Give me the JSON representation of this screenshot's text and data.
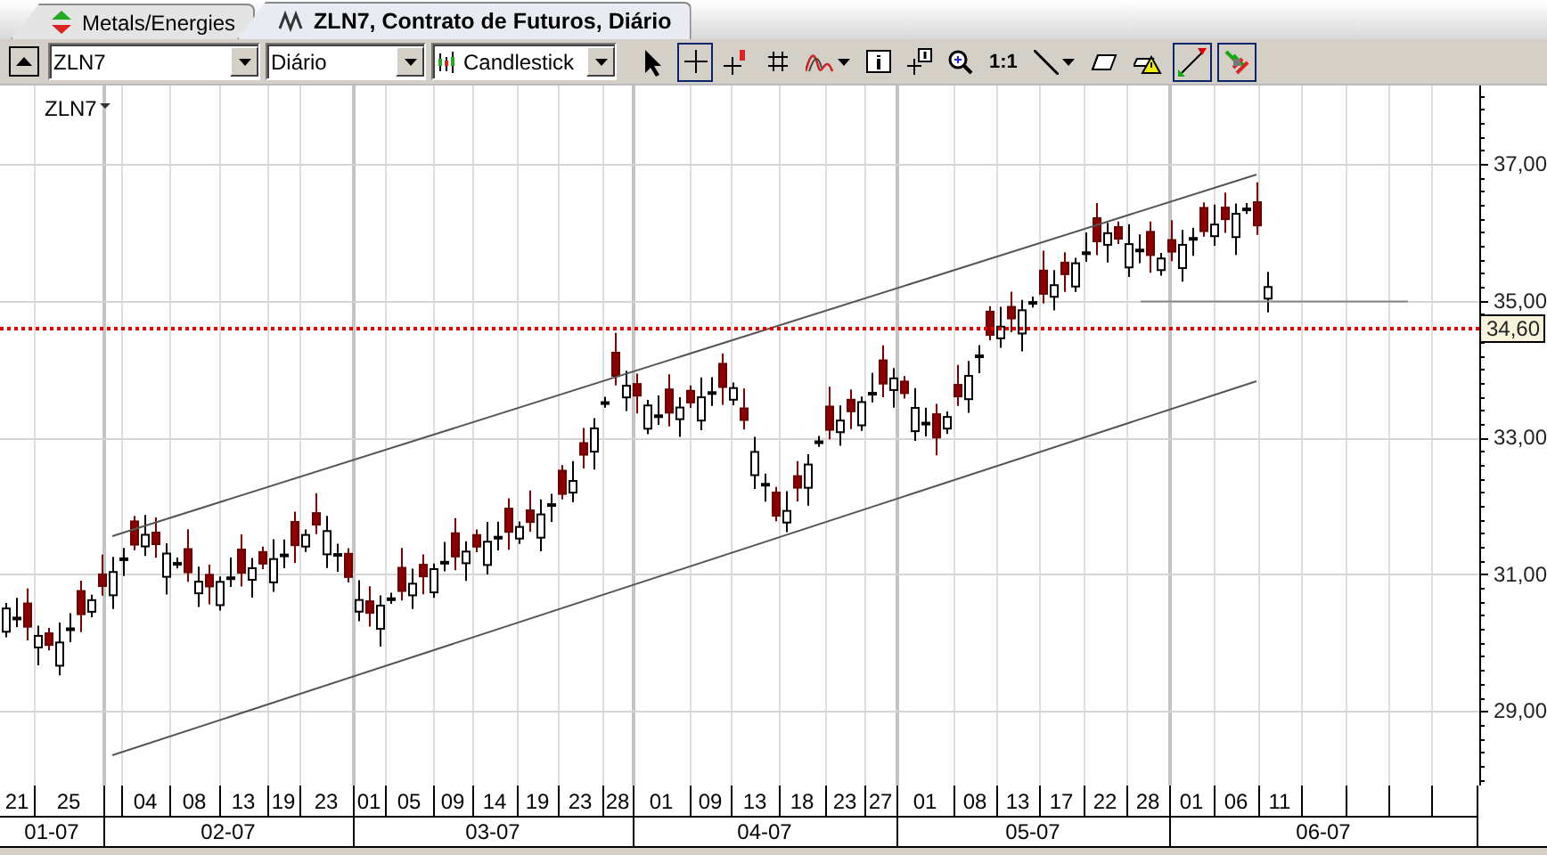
{
  "tabs": [
    {
      "label": "Metals/Energies",
      "kind": "watchlist",
      "selected": false
    },
    {
      "label": "ZLN7, Contrato de Futuros, Diário",
      "kind": "chart",
      "selected": true
    }
  ],
  "toolbar": {
    "symbol": "ZLN7",
    "period": "Diário",
    "chart_type": "Candlestick",
    "tools": [
      {
        "kind": "pointer",
        "selected": false
      },
      {
        "kind": "crosshair",
        "selected": true
      },
      {
        "kind": "marker",
        "selected": false
      },
      {
        "kind": "grid",
        "selected": false
      },
      {
        "kind": "indicator",
        "selected": false
      },
      {
        "kind": "info",
        "selected": false
      },
      {
        "kind": "window",
        "selected": false
      },
      {
        "kind": "zoom",
        "selected": false
      },
      {
        "kind": "ratio",
        "label": "1:1",
        "selected": false
      },
      {
        "kind": "line",
        "selected": false
      },
      {
        "kind": "eraser",
        "selected": false
      },
      {
        "kind": "alert",
        "selected": false
      },
      {
        "kind": "move",
        "selected": true
      },
      {
        "kind": "trades",
        "selected": true
      }
    ]
  },
  "chart": {
    "symbol_label": "ZLN7",
    "y_labels": [
      "37,00",
      "35,00",
      "33,00",
      "31,00",
      "29,00"
    ],
    "last_price": "34,60",
    "days": [
      "21",
      "25",
      "04",
      "08",
      "13",
      "19",
      "23",
      "01",
      "05",
      "09",
      "14",
      "19",
      "23",
      "28",
      "01",
      "09",
      "13",
      "18",
      "23",
      "27",
      "01",
      "08",
      "13",
      "17",
      "22",
      "28",
      "01",
      "06",
      "11"
    ],
    "months": [
      "01-07",
      "02-07",
      "03-07",
      "04-07",
      "05-07",
      "06-07"
    ]
  }
}
